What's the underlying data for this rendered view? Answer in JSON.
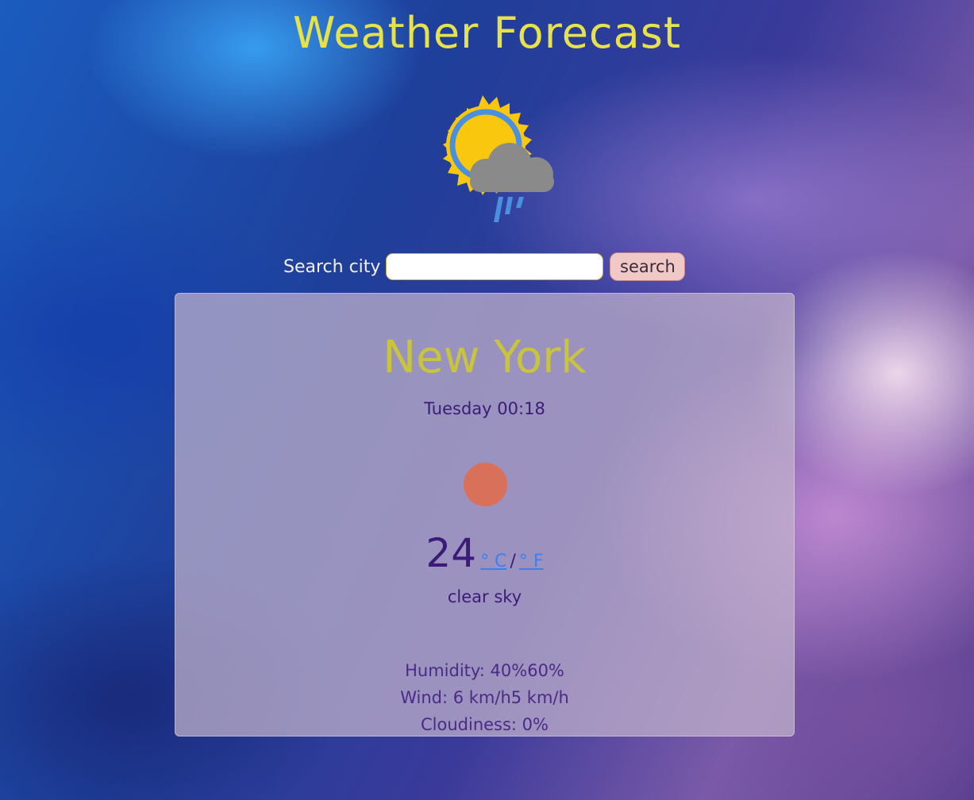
{
  "page": {
    "title": "Weather Forecast",
    "logo_icon": "sun-cloud-rain-icon"
  },
  "search": {
    "label": "Search city",
    "placeholder": "",
    "value": "",
    "button_label": "search"
  },
  "weather": {
    "city": "New York",
    "datetime": "Tuesday 00:18",
    "condition_icon": "clear-sky-sun-icon",
    "temperature": "24",
    "unit_celsius": "° C",
    "unit_separator": "/",
    "unit_fahrenheit": "° F",
    "description": "clear sky",
    "humidity": "Humidity: 40%60%",
    "wind": "Wind: 6 km/h5 km/h",
    "cloudiness": "Cloudiness: 0%"
  },
  "colors": {
    "title": "#e8e24a",
    "city": "#c9c33e",
    "text": "#3b1a78",
    "link": "#3d7ff0",
    "sun_dot": "#d97059",
    "search_button": "#f0c9c6"
  }
}
